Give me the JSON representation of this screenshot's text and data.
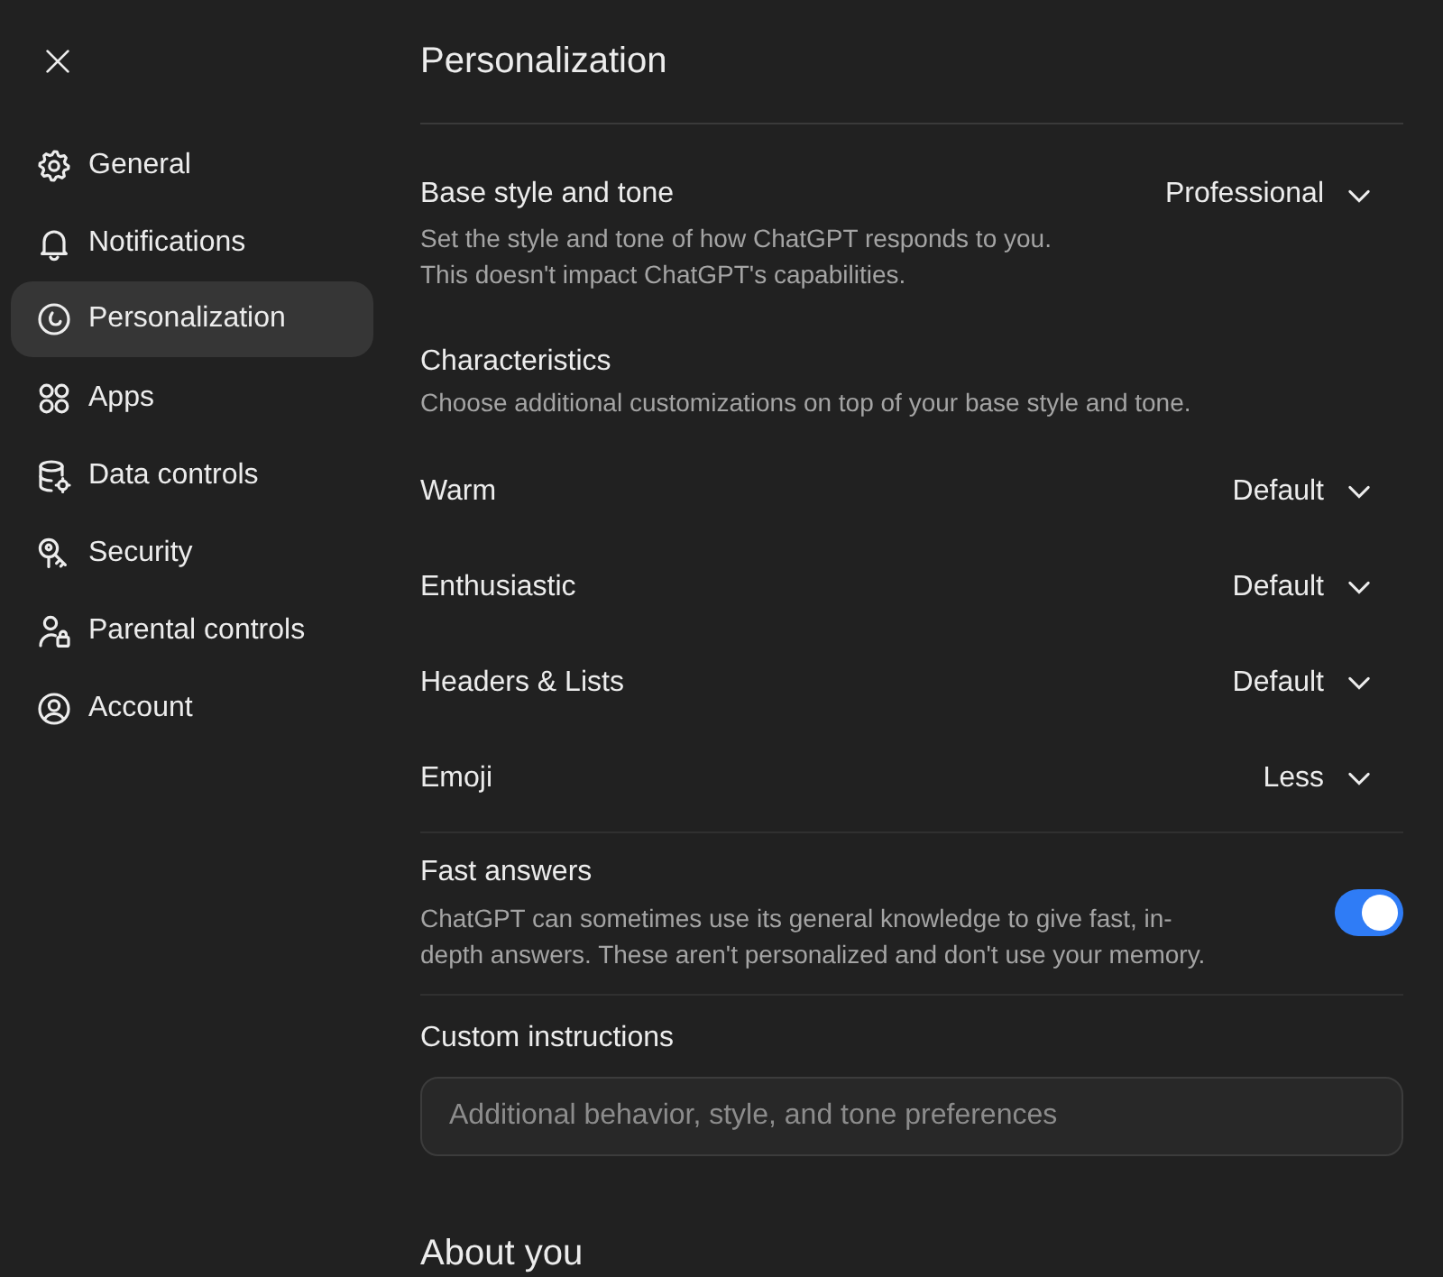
{
  "sidebar": {
    "items": [
      {
        "label": "General",
        "selected": false
      },
      {
        "label": "Notifications",
        "selected": false
      },
      {
        "label": "Personalization",
        "selected": true
      },
      {
        "label": "Apps",
        "selected": false
      },
      {
        "label": "Data controls",
        "selected": false
      },
      {
        "label": "Security",
        "selected": false
      },
      {
        "label": "Parental controls",
        "selected": false
      },
      {
        "label": "Account",
        "selected": false
      }
    ]
  },
  "main": {
    "title": "Personalization",
    "settings": [
      {
        "kind": "select",
        "label": "Base style and tone",
        "description": "Set the style and tone of how ChatGPT responds to you. This doesn't impact ChatGPT's capabilities.",
        "value": "Professional"
      },
      {
        "kind": "heading",
        "label": "Characteristics",
        "description": "Choose additional customizations on top of your base style and tone."
      },
      {
        "kind": "select",
        "label": "Warm",
        "value": "Default"
      },
      {
        "kind": "select",
        "label": "Enthusiastic",
        "value": "Default"
      },
      {
        "kind": "select",
        "label": "Headers & Lists",
        "value": "Default"
      },
      {
        "kind": "select",
        "label": "Emoji",
        "value": "Less"
      },
      {
        "kind": "toggle",
        "label": "Fast answers",
        "description": "ChatGPT can sometimes use its general knowledge to give fast, in-depth answers. These aren't personalized and don't use your memory.",
        "on": true
      },
      {
        "kind": "text_input",
        "label": "Custom instructions",
        "placeholder": "Additional behavior, style, and tone preferences"
      }
    ],
    "next_section": {
      "title": "About you"
    }
  }
}
